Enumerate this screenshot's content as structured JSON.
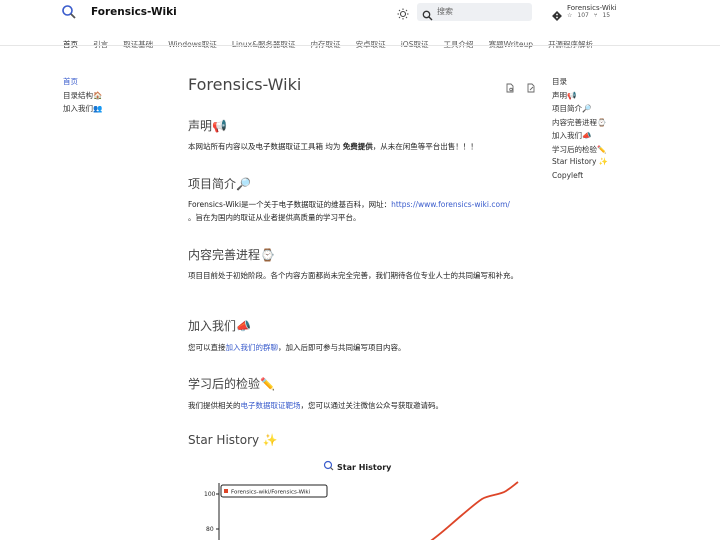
{
  "header": {
    "site_title": "Forensics-Wiki",
    "search_placeholder": "搜索",
    "repo": {
      "name": "Forensics-Wiki",
      "stars": "107",
      "forks": "15"
    }
  },
  "tabs": [
    "首页",
    "引言",
    "取证基础",
    "Windows取证",
    "Linux&服务器取证",
    "内存取证",
    "安卓取证",
    "iOS取证",
    "工具介绍",
    "赛题Writeup",
    "开源程序解析"
  ],
  "leftnav": [
    "首页",
    "目录结构🏠",
    "加入我们👥"
  ],
  "toc": [
    "目录",
    "声明📢",
    "项目简介🔎",
    "内容完善进程⌚",
    "加入我们📣",
    "学习后的检验✏️",
    "Star History ✨",
    "Copyleft"
  ],
  "main": {
    "title": "Forensics-Wiki",
    "sections": [
      {
        "heading": "声明📢"
      },
      {
        "heading": "项目简介🔎"
      },
      {
        "heading": "内容完善进程⌚"
      },
      {
        "heading": "加入我们📣"
      },
      {
        "heading": "学习后的检验✏️"
      },
      {
        "heading": "Star History ✨"
      }
    ],
    "decl_prefix": "本网站所有内容以及电子数据取证工具箱 均为 ",
    "decl_bold": "免费提供",
    "decl_suffix": "，从未在闲鱼等平台出售！！！",
    "intro_prefix": "Forensics-Wiki是一个关于电子数据取证的维基百科，网址：",
    "intro_link": "https://www.forensics-wiki.com/",
    "intro_suffix": "。旨在为国内的取证从业者提供高质量的学习平台。",
    "progress_text": "项目目前处于初始阶段。各个内容方面都尚未完全完善，我们期待各位专业人士的共同编写和补充。",
    "join_prefix": "您可以直接",
    "join_link": "加入我们的群聊",
    "join_suffix": "，加入后即可参与共同编写项目内容。",
    "check_prefix": "我们提供相关的",
    "check_link": "电子数据取证靶场",
    "check_suffix": "，您可以通过关注微信公众号获取邀请码。"
  },
  "star_chart": {
    "title": "Star History",
    "legend": "Forensics-wiki/Forensics-Wiki",
    "y_ticks": [
      "100",
      "80"
    ],
    "color": "#dd4528"
  }
}
